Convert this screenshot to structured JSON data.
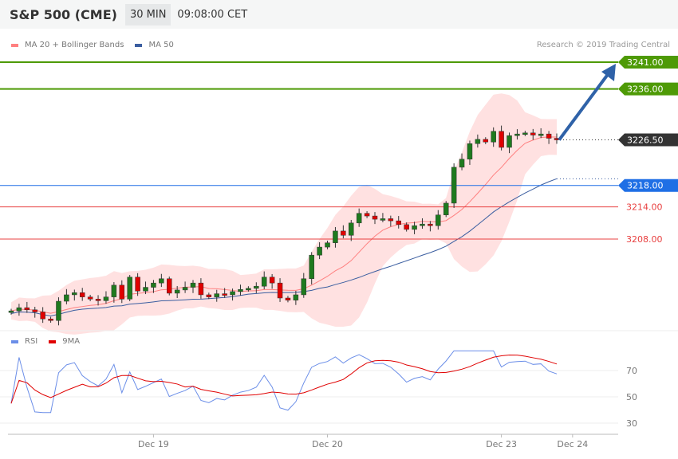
{
  "header": {
    "title": "S&P 500 (CME)",
    "timeframe": "30 MIN",
    "time": "09:08:00 CET"
  },
  "legend": {
    "ma20": "MA 20 + Bollinger Bands",
    "ma50": "MA 50",
    "copyright": "Research © 2019 Trading Central"
  },
  "rsi_legend": {
    "rsi": "RSI",
    "ma": "9MA"
  },
  "colors": {
    "up": "#1e7a1e",
    "down": "#e00000",
    "band": "#ffe1e1",
    "ma20": "#ff8080",
    "ma50": "#3b5ea0",
    "target": "#4e9a06",
    "current": "#333333",
    "support_blue": "#1f6fe5",
    "support_red": "#e84040",
    "rsi": "#6b8ee8"
  },
  "levels": [
    {
      "value": 3241.0,
      "label": "3241.00",
      "kind": "target"
    },
    {
      "value": 3236.0,
      "label": "3236.00",
      "kind": "target"
    },
    {
      "value": 3226.5,
      "label": "3226.50",
      "kind": "current"
    },
    {
      "value": 3218.0,
      "label": "3218.00",
      "kind": "support_blue"
    },
    {
      "value": 3214.0,
      "label": "3214.00",
      "kind": "support_red"
    },
    {
      "value": 3208.0,
      "label": "3208.00",
      "kind": "support_red"
    }
  ],
  "rsi_ticks": [
    {
      "value": 70,
      "label": "70"
    },
    {
      "value": 50,
      "label": "50"
    },
    {
      "value": 30,
      "label": "30"
    }
  ],
  "date_labels": [
    {
      "label": "Dec 19",
      "index": 18
    },
    {
      "label": "Dec 20",
      "index": 40
    },
    {
      "label": "Dec 23",
      "index": 62
    },
    {
      "label": "Dec 24",
      "index": 71
    }
  ],
  "chart_data": {
    "type": "candlestick",
    "closes": [
      3194.6,
      3195.2,
      3194.8,
      3194.4,
      3193.1,
      3192.8,
      3196.4,
      3197.6,
      3198.0,
      3197.2,
      3196.8,
      3196.5,
      3197.2,
      3199.4,
      3196.8,
      3200.9,
      3198.3,
      3199.0,
      3199.8,
      3200.6,
      3197.9,
      3198.5,
      3199.0,
      3199.8,
      3197.6,
      3197.2,
      3197.8,
      3197.6,
      3198.2,
      3198.6,
      3198.8,
      3199.2,
      3200.9,
      3199.8,
      3197.0,
      3196.6,
      3197.6,
      3200.6,
      3205.0,
      3206.5,
      3207.3,
      3209.5,
      3208.7,
      3211.0,
      3212.8,
      3212.3,
      3211.7,
      3211.8,
      3211.4,
      3210.7,
      3209.8,
      3210.5,
      3210.8,
      3210.5,
      3212.5,
      3214.7,
      3221.4,
      3222.9,
      3225.8,
      3226.6,
      3226.1,
      3228.1,
      3225.1,
      3227.3,
      3227.6,
      3227.8,
      3227.4,
      3227.6,
      3226.8,
      3226.5
    ],
    "forecast_target": 3241.0
  }
}
